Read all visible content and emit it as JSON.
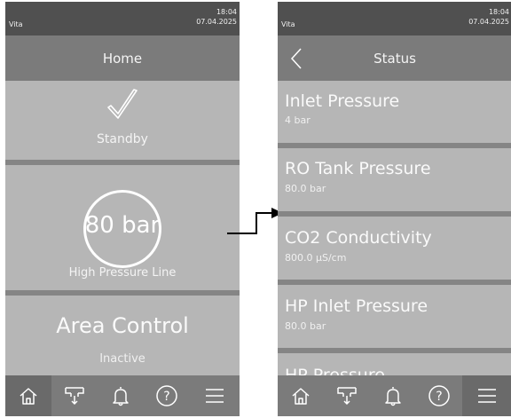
{
  "left_screen": {
    "statusbar": {
      "brand": "Vita",
      "time": "18:04",
      "date": "07.04.2025"
    },
    "header": {
      "title": "Home"
    },
    "tiles": {
      "standby": {
        "label": "Standby",
        "icon": "check-icon"
      },
      "pressure": {
        "value": "80 bar",
        "label": "High Pressure Line"
      },
      "area": {
        "title": "Area Control",
        "state": "Inactive"
      }
    }
  },
  "right_screen": {
    "statusbar": {
      "brand": "Vita",
      "time": "18:04",
      "date": "07.04.2025"
    },
    "header": {
      "title": "Status",
      "back_icon": "chevron-left-icon"
    },
    "items": [
      {
        "title": "Inlet Pressure",
        "value": "4 bar"
      },
      {
        "title": "RO Tank Pressure",
        "value": "80.0 bar"
      },
      {
        "title": "CO2 Conductivity",
        "value": "800.0 µS/cm"
      },
      {
        "title": "HP Inlet Pressure",
        "value": "80.0 bar"
      },
      {
        "title": "HP Pressure",
        "value": ""
      }
    ]
  },
  "navbar": {
    "icons": [
      "home-icon",
      "distribution-icon",
      "bell-icon",
      "help-icon",
      "menu-icon"
    ],
    "active_left": "home-icon",
    "active_right": "menu-icon"
  },
  "colors": {
    "statusbar": "#505050",
    "header": "#7b7b7b",
    "tile": "#b6b6b6",
    "separator": "#858585",
    "navbar": "#7b7b7b"
  }
}
